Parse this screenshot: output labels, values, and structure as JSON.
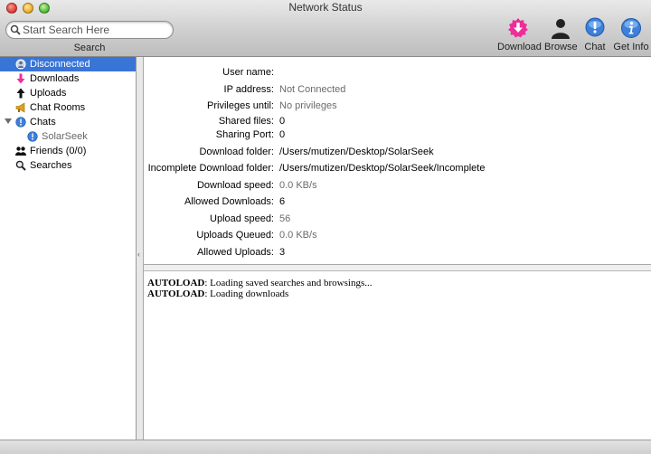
{
  "window": {
    "title": "Network Status"
  },
  "toolbar": {
    "search": {
      "placeholder": "Start Search Here",
      "caption": "Search"
    },
    "buttons": [
      {
        "label": "Download",
        "icon": "download-icon",
        "color": "#ee2d9a"
      },
      {
        "label": "Browse",
        "icon": "browse-person-icon",
        "color": "#222222"
      },
      {
        "label": "Chat",
        "icon": "chat-icon",
        "color": "#3d7fd9"
      },
      {
        "label": "Get Info",
        "icon": "info-icon",
        "color": "#3d7fd9"
      }
    ]
  },
  "sidebar": {
    "items": [
      {
        "label": "Disconnected",
        "icon": "connection-status-icon"
      },
      {
        "label": "Downloads",
        "icon": "download-arrow-icon"
      },
      {
        "label": "Uploads",
        "icon": "upload-arrow-icon"
      },
      {
        "label": "Chat Rooms",
        "icon": "megaphone-icon"
      },
      {
        "label": "Chats",
        "icon": "chat-bubble-icon"
      },
      {
        "label": "SolarSeek",
        "icon": "chat-bubble-icon"
      },
      {
        "label": "Friends (0/0)",
        "icon": "friends-icon"
      },
      {
        "label": "Searches",
        "icon": "magnifier-icon"
      }
    ],
    "selected": "Disconnected",
    "accent": "#3875d7"
  },
  "details": [
    {
      "label": "User name:",
      "value": ""
    },
    {
      "label": "IP  address:",
      "value": "Not Connected"
    },
    {
      "label": "Privileges until:",
      "value": "No privileges"
    },
    {
      "label": "Shared files:",
      "value": "0"
    },
    {
      "label": "Sharing Port:",
      "value": "0"
    },
    {
      "label": "Download folder:",
      "value": "/Users/mutizen/Desktop/SolarSeek"
    },
    {
      "label": "Incomplete Download folder:",
      "value": "/Users/mutizen/Desktop/SolarSeek/Incomplete"
    },
    {
      "label": "Download speed:",
      "value": "0.0 KB/s"
    },
    {
      "label": "Allowed Downloads:",
      "value": "6"
    },
    {
      "label": "Upload speed:",
      "value": "56"
    },
    {
      "label": "Uploads Queued:",
      "value": "0.0 KB/s"
    },
    {
      "label": "Allowed Uploads:",
      "value": "3"
    }
  ],
  "log": [
    {
      "tag": "AUTOLOAD",
      "text": ": Loading saved searches and browsings..."
    },
    {
      "tag": "AUTOLOAD",
      "text": ": Loading downloads"
    }
  ]
}
